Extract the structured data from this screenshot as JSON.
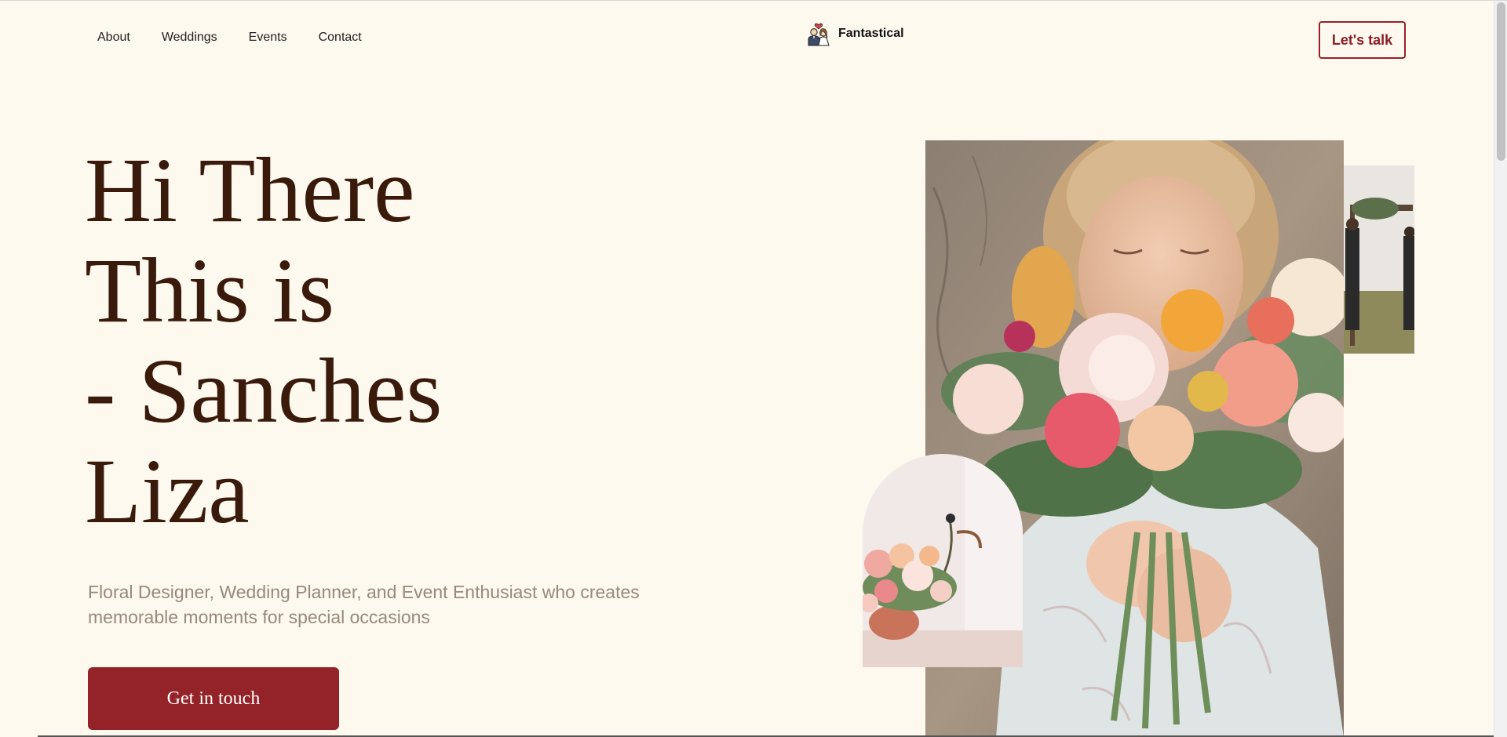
{
  "nav": {
    "items": [
      {
        "label": "About"
      },
      {
        "label": "Weddings"
      },
      {
        "label": "Events"
      },
      {
        "label": "Contact"
      }
    ],
    "brand": "Fantastical",
    "brand_icon": "couple-icon",
    "cta_label": "Let's talk"
  },
  "hero": {
    "title_lines": [
      "Hi There",
      "This is",
      "- Sanches",
      "Liza"
    ],
    "subtitle": "Floral Designer, Wedding Planner, and Event Enthusiast who creates memorable moments for special occasions",
    "button_label": "Get in touch"
  },
  "colors": {
    "background": "#fef9ef",
    "accent": "#932328",
    "title": "#3a1a0a",
    "subtitle": "#958a7c"
  }
}
